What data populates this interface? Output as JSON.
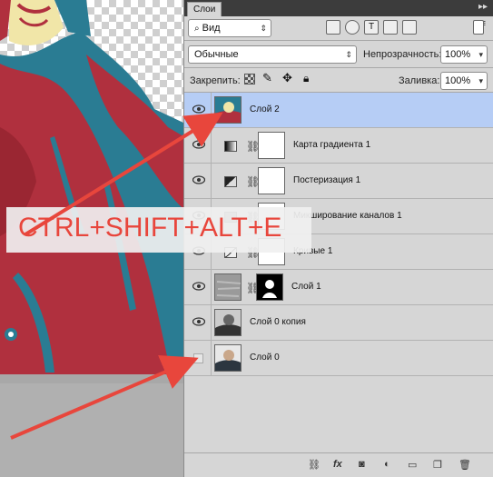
{
  "panel": {
    "tab_label": "Слои",
    "filter_label": "Вид",
    "blend_mode": "Обычные",
    "opacity_label": "Непрозрачность:",
    "opacity_value": "100%",
    "lock_label": "Закрепить:",
    "fill_label": "Заливка:",
    "fill_value": "100%"
  },
  "layers": [
    {
      "name": "Слой 2",
      "selected": true,
      "visible": true
    },
    {
      "name": "Карта градиента 1",
      "visible": true
    },
    {
      "name": "Постеризация 1",
      "visible": true
    },
    {
      "name": "Микширование каналов 1",
      "visible": true
    },
    {
      "name": "Кривые 1",
      "visible": true
    },
    {
      "name": "Слой 1",
      "visible": true
    },
    {
      "name": "Слой 0 копия",
      "visible": true
    },
    {
      "name": "Слой 0",
      "visible": false
    }
  ],
  "overlay": {
    "shortcut": "CTRL+SHIFT+ALT+E",
    "color": "#e8463c"
  },
  "footer": {
    "link_icon": "link-icon",
    "fx_label": "fx"
  }
}
